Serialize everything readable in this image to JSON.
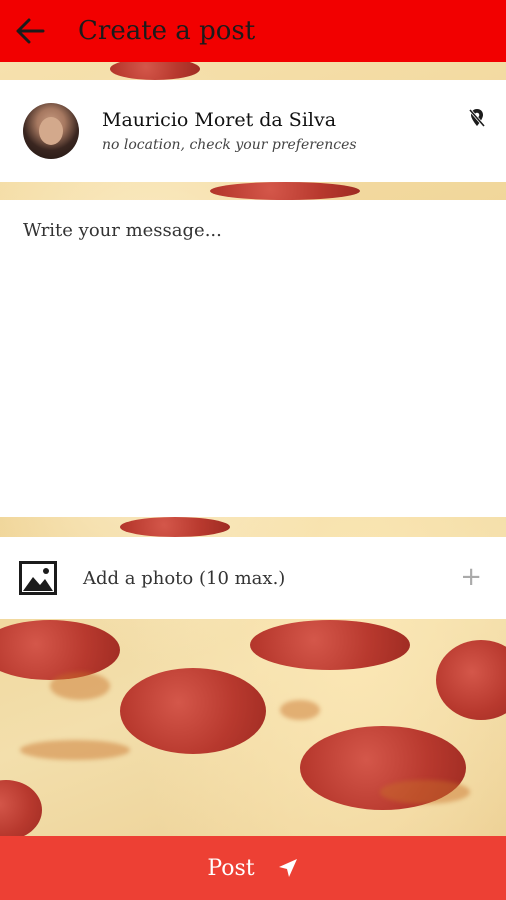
{
  "header": {
    "title": "Create a post"
  },
  "user": {
    "name": "Mauricio Moret da Silva",
    "location": "no location, check your preferences"
  },
  "message": {
    "placeholder": "Write your message..."
  },
  "photo": {
    "label": "Add a photo (10 max.)",
    "add_symbol": "+"
  },
  "footer": {
    "post_label": "Post"
  },
  "colors": {
    "topbar": "#f20000",
    "post_button": "#ed4034"
  }
}
